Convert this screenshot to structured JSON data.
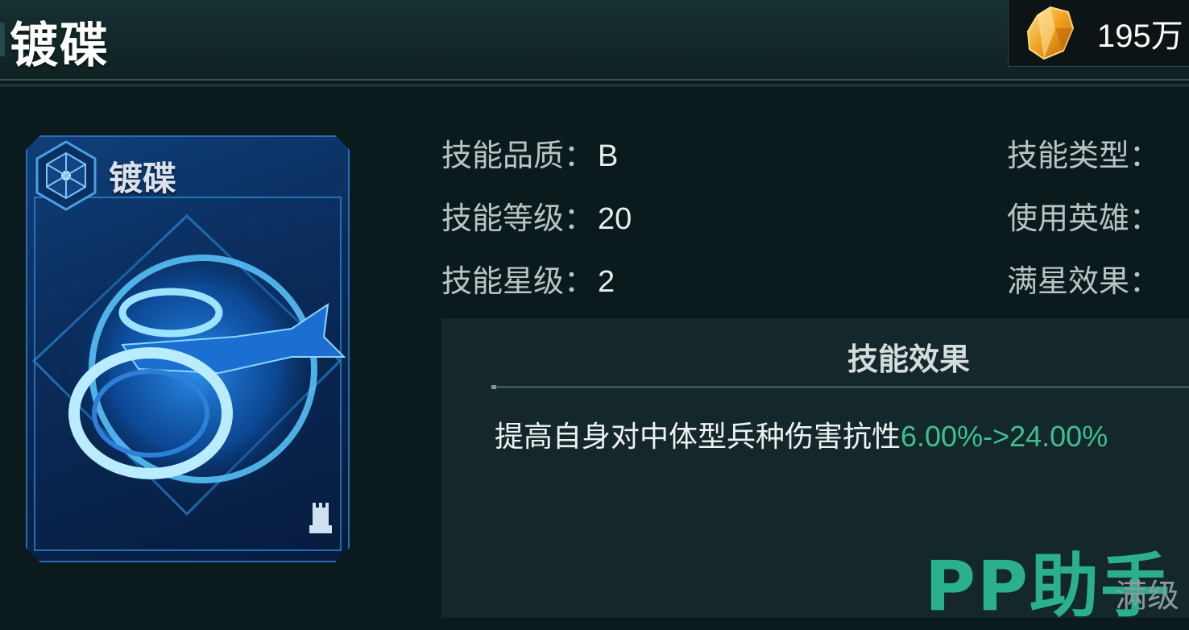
{
  "header": {
    "title": "镀碟",
    "currency_amount": "195万",
    "currency_icon": "amber-crystal-icon"
  },
  "card": {
    "title": "镀碟",
    "emblem_icon": "hexagon-emblem-icon",
    "art_icon": "ring-ship-icon",
    "rank_icon": "tower-icon"
  },
  "info_left": [
    {
      "label": "技能品质：",
      "value": "B"
    },
    {
      "label": "技能等级：",
      "value": "20"
    },
    {
      "label": "技能星级：",
      "value": "2"
    }
  ],
  "info_right": [
    {
      "label": "技能类型：",
      "value": ""
    },
    {
      "label": "使用英雄：",
      "value": ""
    },
    {
      "label": "满星效果：",
      "value": ""
    }
  ],
  "effect": {
    "title": "技能效果",
    "text": "提高自身对中体型兵种伤害抗性",
    "value": "6.00%->24.00%",
    "value_color": "#3fc08f"
  },
  "watermark": "PP助手",
  "max_level_label": "满级"
}
